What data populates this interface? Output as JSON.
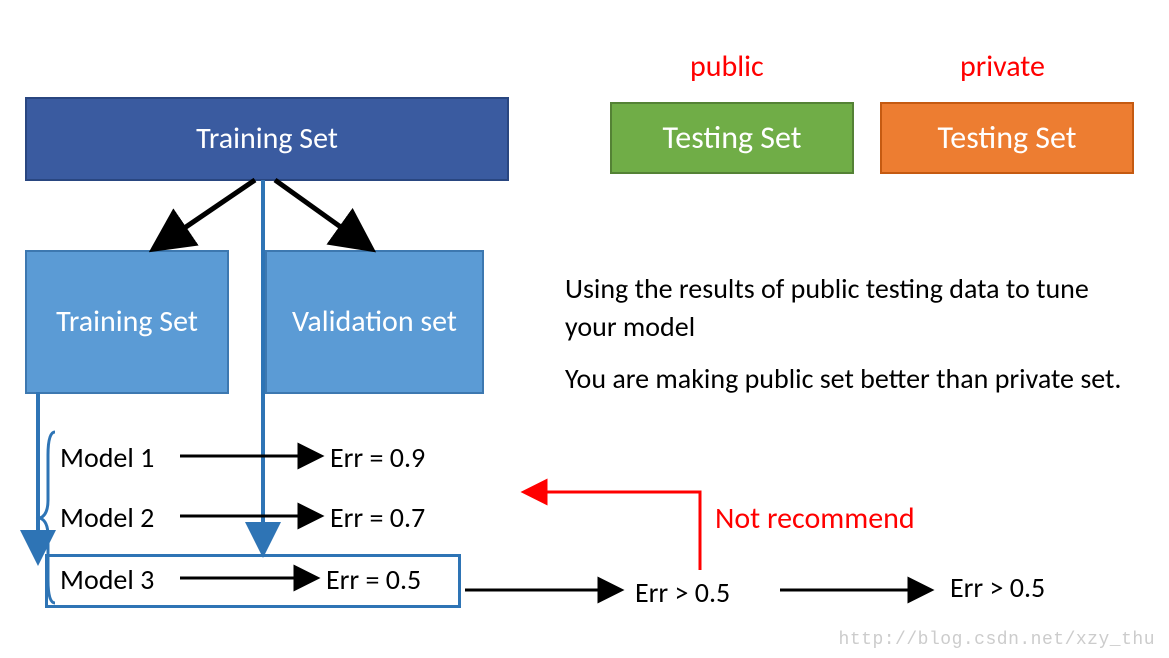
{
  "colors": {
    "blue_main": "#3a5ba0",
    "blue_light": "#5b9bd5",
    "green": "#70ad47",
    "orange": "#ed7d31",
    "red": "#ff0000",
    "select_blue": "#2e74b5"
  },
  "boxes": {
    "training_main": "Training Set",
    "training_sub": "Training Set",
    "validation_sub": "Validation set",
    "testing_public": "Testing Set",
    "testing_private": "Testing Set"
  },
  "labels": {
    "public": "public",
    "private": "private",
    "not_recommend": "Not recommend"
  },
  "body": {
    "line1": "Using the results of public testing data to tune your model",
    "line2": "You are making public set better than private set."
  },
  "models": {
    "m1": "Model 1",
    "m2": "Model 2",
    "m3": "Model 3"
  },
  "errors": {
    "e1": "Err = 0.9",
    "e2": "Err = 0.7",
    "e3": "Err = 0.5",
    "pub": "Err > 0.5",
    "priv": "Err > 0.5"
  },
  "watermark": "http://blog.csdn.net/xzy_thu"
}
